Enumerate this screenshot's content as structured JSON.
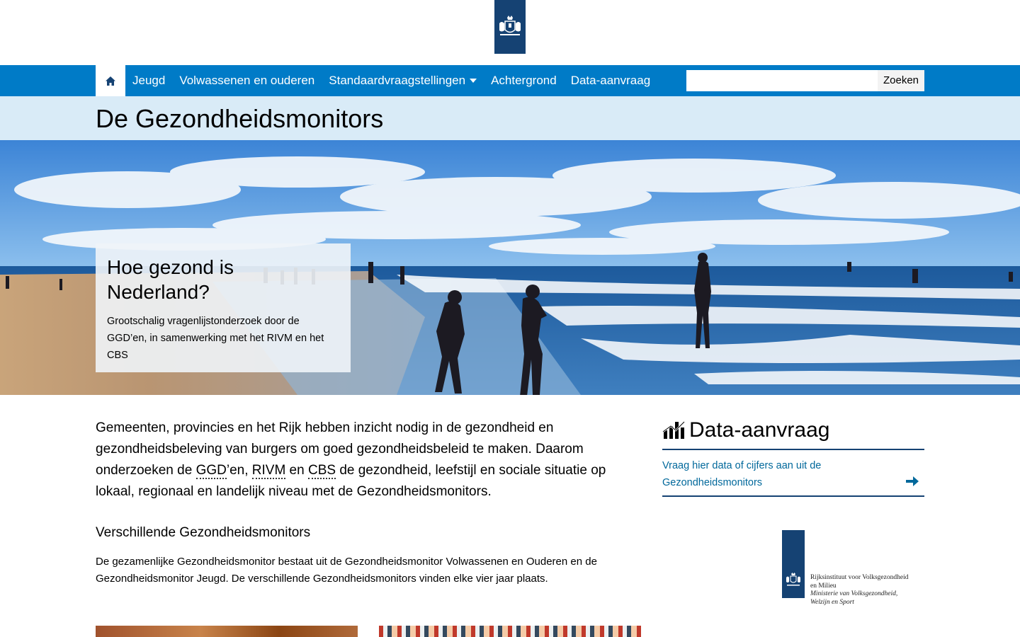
{
  "nav": {
    "items": [
      {
        "label": "Jeugd"
      },
      {
        "label": "Volwassenen en ouderen"
      },
      {
        "label": "Standaardvraagstellingen"
      },
      {
        "label": "Achtergrond"
      },
      {
        "label": "Data-aanvraag"
      }
    ],
    "search_placeholder": "",
    "search_button": "Zoeken"
  },
  "page": {
    "title": "De Gezondheidsmonitors"
  },
  "hero": {
    "title": "Hoe gezond is Nederland?",
    "text": "Grootschalig vragenlijstonderzoek door de GGD’en, in samenwerking met het RIVM en het CBS"
  },
  "main": {
    "intro_part1": "Gemeenten, provincies en het Rijk hebben inzicht nodig in de gezondheid en gezondheidsbeleving van burgers om goed gezondheidsbeleid te maken. Daarom onderzoeken de ",
    "abbr_ggd": "GGD",
    "intro_part2": "’en, ",
    "abbr_rivm": "RIVM",
    "intro_part3": " en ",
    "abbr_cbs": "CBS",
    "intro_part4": " de gezondheid, leefstijl en sociale situatie op lokaal, regionaal en landelijk niveau met de Gezondheidsmonitors.",
    "subhead": "Verschillende Gezondheidsmonitors",
    "body": "De gezamenlijke Gezondheidsmonitor bestaat uit de Gezondheidsmonitor Volwassenen en Ouderen en de Gezondheidsmonitor Jeugd. De verschillende Gezondheidsmonitors vinden elke vier jaar plaats."
  },
  "sidebar": {
    "title": "Data-aanvraag",
    "link": "Vraag hier data of cijfers aan uit de Gezondheidsmonitors",
    "logo_line1": "Rijksinstituut voor Volksgezondheid",
    "logo_line2": "en Milieu",
    "logo_line3": "Ministerie van Volksgezondheid,",
    "logo_line4": "Welzijn en Sport"
  },
  "colors": {
    "nav": "#007bc7",
    "title_band": "#d9ebf7",
    "rijks_blue": "#154273",
    "link": "#01689b"
  }
}
